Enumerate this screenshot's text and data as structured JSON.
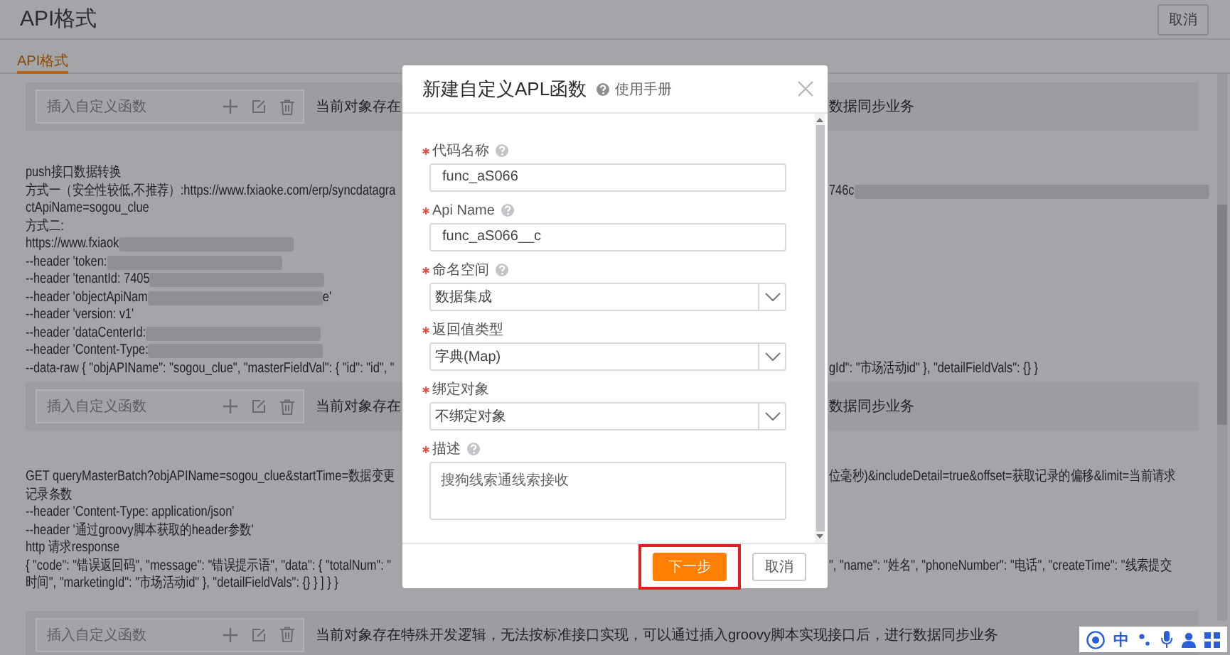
{
  "header": {
    "title": "API格式",
    "cancel_button": "取消"
  },
  "tabs": [
    {
      "label": "API格式",
      "selected": true
    }
  ],
  "content": [
    {
      "kind": "function_row",
      "placeholder": "插入自定义函数",
      "left": "当前对象存在",
      "right": "数据同步业务"
    },
    {
      "kind": "text_block",
      "lines": [
        {
          "left": [
            {
              "kind": "text",
              "text": "push接口数据转换"
            }
          ]
        },
        {
          "left": [
            {
              "kind": "text",
              "text": "方式一（安全性较低,不推荐）:https://www.fxiaoke.com/erp/syncdatagra"
            }
          ],
          "right": [
            {
              "kind": "text",
              "text": "746c"
            },
            {
              "kind": "blur"
            }
          ]
        },
        {
          "left": [
            {
              "kind": "text",
              "text": "ctApiName=sogou_clue"
            }
          ]
        },
        {
          "left": [
            {
              "kind": "text",
              "text": "方式二:"
            }
          ]
        },
        {
          "left": [
            {
              "kind": "text",
              "text": "https://www.fxiaok"
            },
            {
              "kind": "blur"
            }
          ]
        },
        {
          "left": [
            {
              "kind": "text",
              "text": "--header 'token: "
            },
            {
              "kind": "blur"
            }
          ]
        },
        {
          "left": [
            {
              "kind": "text",
              "text": "--header 'tenantId: 7405"
            },
            {
              "kind": "blur"
            }
          ]
        },
        {
          "left": [
            {
              "kind": "text",
              "text": "--header 'objectApiNam"
            },
            {
              "kind": "blur"
            },
            {
              "kind": "text",
              "text": "e'"
            }
          ]
        },
        {
          "left": [
            {
              "kind": "text",
              "text": "--header 'version: v1'"
            }
          ]
        },
        {
          "left": [
            {
              "kind": "text",
              "text": "--header 'dataCenterId: "
            },
            {
              "kind": "blur"
            }
          ]
        },
        {
          "left": [
            {
              "kind": "text",
              "text": "--header 'Content-Type:"
            },
            {
              "kind": "blur"
            }
          ]
        },
        {
          "left": [
            {
              "kind": "text",
              "text": "--data-raw { \"objAPIName\": \"sogou_clue\", \"masterFieldVal\": { \"id\": \"id\", \""
            }
          ],
          "right": [
            {
              "kind": "text",
              "text": "gId\": \"市场活动id\" }, \"detailFieldVals\": {} }"
            }
          ]
        }
      ]
    },
    {
      "kind": "function_row",
      "placeholder": "插入自定义函数",
      "left": "当前对象存在",
      "right": "数据同步业务"
    },
    {
      "kind": "text_block",
      "lines": [
        {
          "left": [
            {
              "kind": "text",
              "text": "GET queryMasterBatch?objAPIName=sogou_clue&startTime=数据变更"
            }
          ],
          "right": [
            {
              "kind": "text",
              "text": "位毫秒)&includeDetail=true&offset=获取记录的偏移&limit=当前请求"
            }
          ]
        },
        {
          "left": [
            {
              "kind": "text",
              "text": "记录条数"
            }
          ]
        },
        {
          "left": [
            {
              "kind": "text",
              "text": "--header 'Content-Type: application/json'"
            }
          ]
        },
        {
          "left": [
            {
              "kind": "text",
              "text": "--header '通过groovy脚本获取的header参数'"
            }
          ]
        },
        {
          "left": [
            {
              "kind": "text",
              "text": "http 请求response"
            }
          ]
        },
        {
          "left": [
            {
              "kind": "text",
              "text": "{ \"code\": \"错误返回码\", \"message\": \"错误提示语\", \"data\": { \"totalNum\": \""
            }
          ],
          "right": [
            {
              "kind": "text",
              "text": "\", \"name\": \"姓名\", \"phoneNumber\": \"电话\", \"createTime\": \"线索提交"
            }
          ]
        },
        {
          "left": [
            {
              "kind": "text",
              "text": "时间\", \"marketingId\": \"市场活动id\" }, \"detailFieldVals\": {} } ] } }"
            }
          ]
        }
      ]
    },
    {
      "kind": "function_row",
      "placeholder": "插入自定义函数",
      "left": "当前对象存在特殊开发逻辑，无法按标准接口实现，可以通过插入groovy脚本实现接口后，进行数据同步业务"
    }
  ],
  "dialog": {
    "title": "新建自定义APL函数",
    "help_link": "使用手册",
    "fields": [
      {
        "kind": "input",
        "label": "代码名称",
        "required": true,
        "help": true,
        "value": "func_aS066"
      },
      {
        "kind": "input",
        "label": "Api Name",
        "required": true,
        "help": true,
        "value": "func_aS066__c"
      },
      {
        "kind": "select",
        "label": "命名空间",
        "required": true,
        "help": true,
        "value": "数据集成"
      },
      {
        "kind": "select",
        "label": "返回值类型",
        "required": true,
        "help": false,
        "value": "字典(Map)"
      },
      {
        "kind": "select",
        "label": "绑定对象",
        "required": true,
        "help": false,
        "value": "不绑定对象"
      },
      {
        "kind": "textarea",
        "label": "描述",
        "required": true,
        "help": true,
        "value": "搜狗线索通线索接收"
      }
    ],
    "buttons": [
      {
        "label": "下一步",
        "primary": true,
        "highlighted": true
      },
      {
        "label": "取消",
        "primary": false,
        "highlighted": false
      }
    ]
  },
  "ime_toolbar": {
    "language": "中"
  }
}
